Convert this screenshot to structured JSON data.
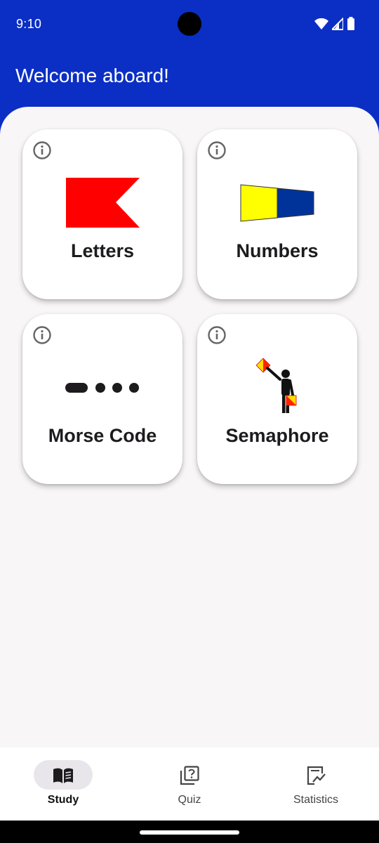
{
  "status_bar": {
    "time": "9:10",
    "icons": [
      "wifi-icon",
      "cell-signal-icon",
      "battery-icon"
    ]
  },
  "app_bar": {
    "title": "Welcome aboard!"
  },
  "cards": [
    {
      "label": "Letters",
      "art": "flag-b-icon"
    },
    {
      "label": "Numbers",
      "art": "pennant-1-icon"
    },
    {
      "label": "Morse Code",
      "art": "morse-code-icon"
    },
    {
      "label": "Semaphore",
      "art": "semaphore-figure-icon"
    }
  ],
  "bottom_nav": {
    "items": [
      {
        "label": "Study",
        "icon": "book-icon",
        "active": true
      },
      {
        "label": "Quiz",
        "icon": "quiz-icon",
        "active": false
      },
      {
        "label": "Statistics",
        "icon": "statistics-icon",
        "active": false
      }
    ]
  },
  "colors": {
    "primary": "#0b2fc4",
    "background": "#f8f6f7",
    "flag_red": "#ff0000",
    "pennant_yellow": "#ffff00",
    "pennant_blue": "#003399"
  }
}
